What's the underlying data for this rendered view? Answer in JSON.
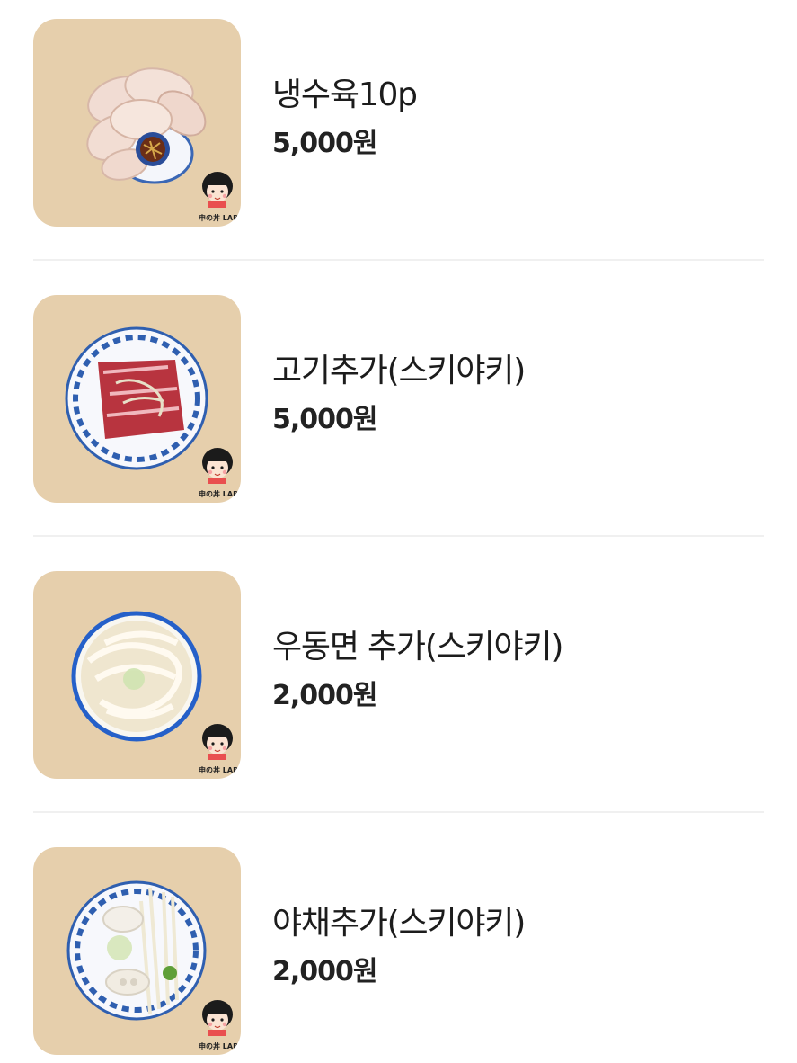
{
  "menu": {
    "items": [
      {
        "name": "냉수육10p",
        "price": "5,000원",
        "image_icon": "boiled-pork-plate"
      },
      {
        "name": "고기추가(스키야키)",
        "price": "5,000원",
        "image_icon": "raw-beef-plate"
      },
      {
        "name": "우동면 추가(스키야키)",
        "price": "2,000원",
        "image_icon": "udon-noodle-bowl"
      },
      {
        "name": "야채추가(스키야키)",
        "price": "2,000원",
        "image_icon": "vegetable-plate"
      }
    ],
    "brand_mark": "申の丼 LAB"
  },
  "colors": {
    "thumb_bg": "#e6cfac",
    "divider": "#f0f0f0",
    "text": "#1c1c1c",
    "plate_blue": "#2f5fb0"
  }
}
